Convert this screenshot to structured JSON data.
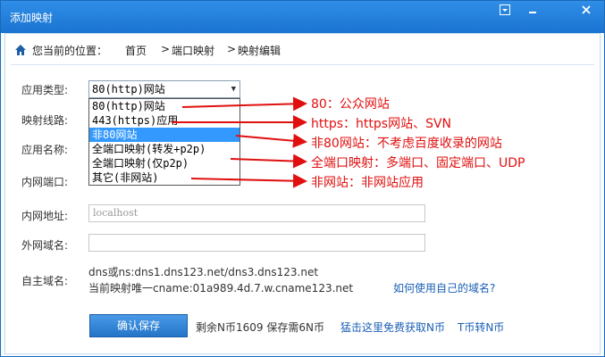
{
  "window": {
    "title": "添加映射",
    "menu_icon": "dropdown-menu-icon",
    "minimize_icon": "minimize-icon",
    "close_icon": "close-icon"
  },
  "breadcrumb": {
    "prefix": "您当前的位置：",
    "home": "首页",
    "sep1": ">",
    "level1": "端口映射",
    "sep2": ">",
    "level2": "映射编辑"
  },
  "form": {
    "app_type_label": "应用类型:",
    "app_type_value": "80(http)网站",
    "line_label": "映射线路:",
    "app_name_label": "应用名称:",
    "inner_port_label": "内网端口:",
    "inner_addr_label": "内网地址:",
    "inner_addr_placeholder": "localhost",
    "outer_domain_label": "外网域名:",
    "own_domain_label": "自主域名:",
    "dns_text": "dns或ns:dns1.dns123.net/dns3.dns123.net",
    "cname_text": "当前映射唯一cname:01a989.4d.7.w.cname123.net",
    "own_domain_link": "如何使用自己的域名?"
  },
  "dropdown": {
    "options": [
      "80(http)网站",
      "443(https)应用",
      "非80网站",
      "全端口映射(转发+p2p)",
      "全端口映射(仅p2p)",
      "其它(非网站)"
    ],
    "selected_index": 2
  },
  "annotations": [
    "80：公众网站",
    "https：https网站、SVN",
    "非80网站：不考虑百度收录的网站",
    "全端口映射：多端口、固定端口、UDP",
    "非网站：非网站应用"
  ],
  "footer": {
    "save_label": "确认保存",
    "balance_text": "剩余N币1609 保存需6N币",
    "free_link": "猛击这里免费获取N币",
    "transfer_link": "T币转N币"
  },
  "colors": {
    "titlebar": "#1a73d0",
    "annotation": "#e01010",
    "link": "#1a5fb4",
    "selected_option": "#3399ff"
  }
}
